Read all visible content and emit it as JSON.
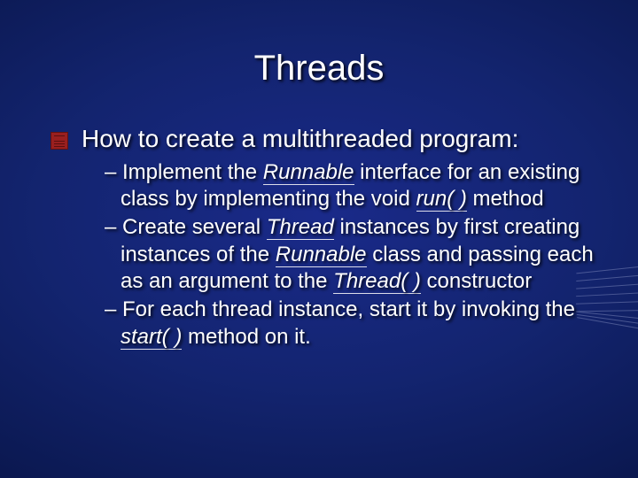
{
  "slide": {
    "title": "Threads",
    "bullet": "How to create a multithreaded program:",
    "subs": {
      "s1": {
        "dash": "– ",
        "p1": "Implement the ",
        "kw1": "Runnable",
        "p2": " interface for an existing class by implementing the void ",
        "kw2": "run( )",
        "p3": " method"
      },
      "s2": {
        "dash": "– ",
        "p1": "Create several ",
        "kw1": "Thread",
        "p2": " instances by first creating instances of the ",
        "kw2": "Runnable",
        "p3": " class and passing each as an argument to the ",
        "kw3": "Thread( )",
        "p4": " constructor"
      },
      "s3": {
        "dash": "– ",
        "p1": "For each thread instance, start it by invoking the ",
        "kw1": "start( )",
        "p2": " method on it."
      }
    }
  }
}
